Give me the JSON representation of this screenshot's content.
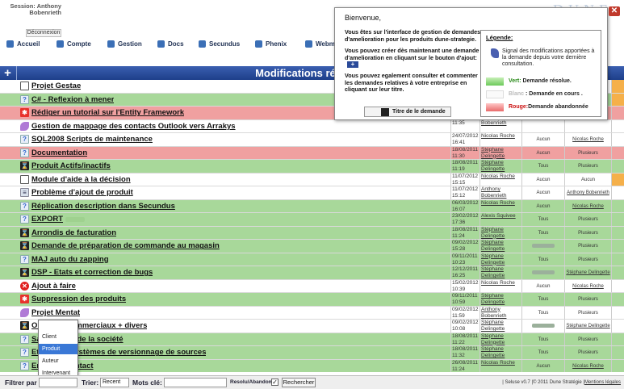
{
  "header": {
    "session_label": "Session: Anthony",
    "session_name": "Bobenrieth",
    "logout_label": "Déconnexion",
    "logo": "DUNE",
    "nav": [
      {
        "label": "Accueil",
        "color": "#3b6fb6"
      },
      {
        "label": "Compte",
        "color": "#3b6fb6"
      },
      {
        "label": "Gestion",
        "color": "#3b6fb6"
      },
      {
        "label": "Docs",
        "color": "#3b6fb6"
      },
      {
        "label": "Secundus",
        "color": "#3b6fb6"
      },
      {
        "label": "Phenix",
        "color": "#3b6fb6"
      },
      {
        "label": "Webmail",
        "color": "#3b6fb6"
      }
    ]
  },
  "main": {
    "add_label": "+",
    "title": "Modifications récentes"
  },
  "colors": {
    "white": "#ffffff",
    "green": "#a8d89a",
    "red": "#f0a0a0",
    "orange": "#f5b04a"
  },
  "rows": [
    {
      "title": "Projet Gestae",
      "icon": "doc-icon",
      "color": "white",
      "date": "",
      "time": "",
      "author_first": "",
      "author_last": "",
      "assigned": "",
      "dest": "",
      "edge": "orange"
    },
    {
      "title": "C# - Reflexion à mener",
      "icon": "question-icon",
      "color": "green",
      "date": "",
      "time": "",
      "author_first": "",
      "author_last": "",
      "assigned": "",
      "dest": "",
      "edge": "orange"
    },
    {
      "title": "Rédiger un tutorial sur l'Entity Framework",
      "icon": "star-icon",
      "color": "red",
      "date": "",
      "time": "",
      "author_first": "",
      "author_last": "",
      "assigned": "",
      "dest": "",
      "edge": "red"
    },
    {
      "title": "Gestion de mappage des contacts Outlook vers Arrakys",
      "icon": "feather-icon",
      "color": "white",
      "date": "",
      "time": "11:35",
      "author_first": "",
      "author_last": "Bobenrieth",
      "assigned": "",
      "dest": "",
      "edge": "white"
    },
    {
      "title": "SQL2008 Scripts de maintenance",
      "icon": "question-icon",
      "color": "white",
      "date": "24/07/2012",
      "time": "16:41",
      "author_first": "Nicolas Roche",
      "author_last": "",
      "assigned": "Aucun",
      "dest": "Nicolas Roche",
      "edge": "white"
    },
    {
      "title": "Documentation",
      "icon": "question-icon",
      "color": "red",
      "date": "18/08/2011",
      "time": "11:30",
      "author_first": "Stéphane",
      "author_last": "Delingette",
      "assigned": "Aucun",
      "dest": "Plusieurs",
      "edge": "red"
    },
    {
      "title": "Produit Actifs/inactifs",
      "icon": "hourglass-icon",
      "color": "green",
      "date": "18/08/2011",
      "time": "11:19",
      "author_first": "Stéphane",
      "author_last": "Delingette",
      "assigned": "Tous",
      "dest": "Plusieurs",
      "edge": "green"
    },
    {
      "title": "Module d'aide à la décision",
      "icon": "doc-icon",
      "color": "white",
      "date": "11/07/2012",
      "time": "15:15",
      "author_first": "Nicolas Roche",
      "author_last": "",
      "assigned": "Aucun",
      "dest": "Aucun",
      "edge": "orange"
    },
    {
      "title": "Problème d'ajout de produit",
      "icon": "stack-icon",
      "color": "white",
      "date": "11/07/2012",
      "time": "15:12",
      "author_first": "Anthony",
      "author_last": "Bobenrieth",
      "assigned": "Aucun",
      "dest": "Anthony Bobenrieth",
      "edge": "white"
    },
    {
      "title": "Réplication description dans Secundus",
      "icon": "question-icon",
      "color": "green",
      "date": "06/03/2012",
      "time": "16:07",
      "author_first": "Nicolas Roche",
      "author_last": "",
      "assigned": "Aucun",
      "dest": "Nicolas Roche",
      "edge": "green"
    },
    {
      "title": "EXPORT",
      "icon": "question-icon",
      "color": "green",
      "date": "23/02/2012",
      "time": "17:36",
      "author_first": "Alexis Squivee",
      "author_last": "",
      "assigned": "Tous",
      "dest": "Plusieurs",
      "edge": "green"
    },
    {
      "title": "Arrondis de facturation",
      "icon": "hourglass-icon",
      "color": "green",
      "date": "18/08/2011",
      "time": "11:24",
      "author_first": "Stéphane",
      "author_last": "Delingette",
      "assigned": "Tous",
      "dest": "Plusieurs",
      "edge": "green"
    },
    {
      "title": "Demande de préparation de commande au magasin",
      "icon": "hourglass-icon",
      "color": "green",
      "date": "09/02/2012",
      "time": "15:28",
      "author_first": "Stéphane",
      "author_last": "Delingette",
      "assigned": "",
      "dest": "Plusieurs",
      "edge": "green"
    },
    {
      "title": "MAJ auto du zapping",
      "icon": "question-icon",
      "color": "green",
      "date": "09/11/2011",
      "time": "10:23",
      "author_first": "Stéphane",
      "author_last": "Delingette",
      "assigned": "Tous",
      "dest": "Plusieurs",
      "edge": "green"
    },
    {
      "title": "DSP - Etats et correction de bugs",
      "icon": "hourglass-icon",
      "color": "green",
      "date": "12/12/2011",
      "time": "16:25",
      "author_first": "Stéphane",
      "author_last": "Delingette",
      "assigned": "",
      "dest": "Stéphane Delingette",
      "edge": "green"
    },
    {
      "title": "Ajout à faire",
      "icon": "x-icon",
      "color": "white",
      "date": "15/02/2012",
      "time": "10:39",
      "author_first": "Nicolas Roche",
      "author_last": "",
      "assigned": "Aucun",
      "dest": "Nicolas Roche",
      "edge": "white"
    },
    {
      "title": "Suppression des produits",
      "icon": "star-icon",
      "color": "green",
      "date": "09/11/2011",
      "time": "10:59",
      "author_first": "Stéphane",
      "author_last": "Delingette",
      "assigned": "Tous",
      "dest": "Plusieurs",
      "edge": "green"
    },
    {
      "title": "Projet Mentat",
      "icon": "feather-icon",
      "color": "white",
      "date": "09/02/2012",
      "time": "11:59",
      "author_first": "Anthony",
      "author_last": "Bobenrieth",
      "assigned": "Tous",
      "dest": "Plusieurs",
      "edge": "white"
    },
    {
      "title": "Objectifs commerciaux + divers",
      "icon": "hourglass-icon",
      "color": "white",
      "date": "09/02/2012",
      "time": "10:08",
      "author_first": "Stéphane",
      "author_last": "Delingette",
      "assigned": "",
      "dest": "Stéphane Delingette",
      "edge": "white"
    },
    {
      "title": "Sauvegarde de la société",
      "icon": "question-icon",
      "color": "green",
      "date": "18/08/2011",
      "time": "11:22",
      "author_first": "Stéphane",
      "author_last": "Delingette",
      "assigned": "Tous",
      "dest": "Plusieurs",
      "edge": "green"
    },
    {
      "title": "Etude des systèmes de versionnage de sources",
      "icon": "question-icon",
      "color": "green",
      "date": "18/08/2011",
      "time": "11:32",
      "author_first": "Stéphane",
      "author_last": "Delingette",
      "assigned": "Tous",
      "dest": "Plusieurs",
      "edge": "green"
    },
    {
      "title": "Envoi du contact",
      "icon": "question-icon",
      "color": "green",
      "date": "26/08/2011",
      "time": "11:24",
      "author_first": "Nicolas Roche",
      "author_last": "",
      "assigned": "Aucun",
      "dest": "Nicolas Roche",
      "edge": "green"
    }
  ],
  "welcome": {
    "close_label": "✕",
    "title": "Bienvenue,",
    "para1": "Vous êtes sur l'interface de gestion de demandes d'amelioration pour les produits dune-strategie.",
    "para2": "Vous pouvez créer dès maintenant une demande d'amelioration en cliquant sur le bouton d'ajout:",
    "para2_button": "+",
    "para3": "Vous pouvez egalement consulter et commenter les demandes relatives à votre entreprise en cliquant sur leur titre.",
    "title_button": "Titre de le demande",
    "legend": {
      "title": "Légende:",
      "item1": "Signal des modifications apportées à la demande depuis votre dernière consultation.",
      "green_word": "Vert:",
      "green_text": "Demande résolue.",
      "white_word": "Blanc",
      "white_text": ": Demande en cours .",
      "red_word": "Rouge:",
      "red_text": "Demande abandonnée"
    }
  },
  "dropdown": {
    "options": [
      "Client",
      "Produit",
      "Auteur",
      "Intervenant"
    ],
    "selected": "Produit"
  },
  "filterbar": {
    "filter_label": "Filtrer par",
    "sort_label": "Trier:",
    "sort_value": "Recent",
    "keywords_label": "Mots clé:",
    "resolved_label": "Resolu/Abandon:",
    "resolved_checked": "✓",
    "search_button": "Rechercher",
    "footer_text": "| Seluse v0.7 |© 2011 Dune Stratégie |",
    "footer_link": "Mentions légales"
  }
}
